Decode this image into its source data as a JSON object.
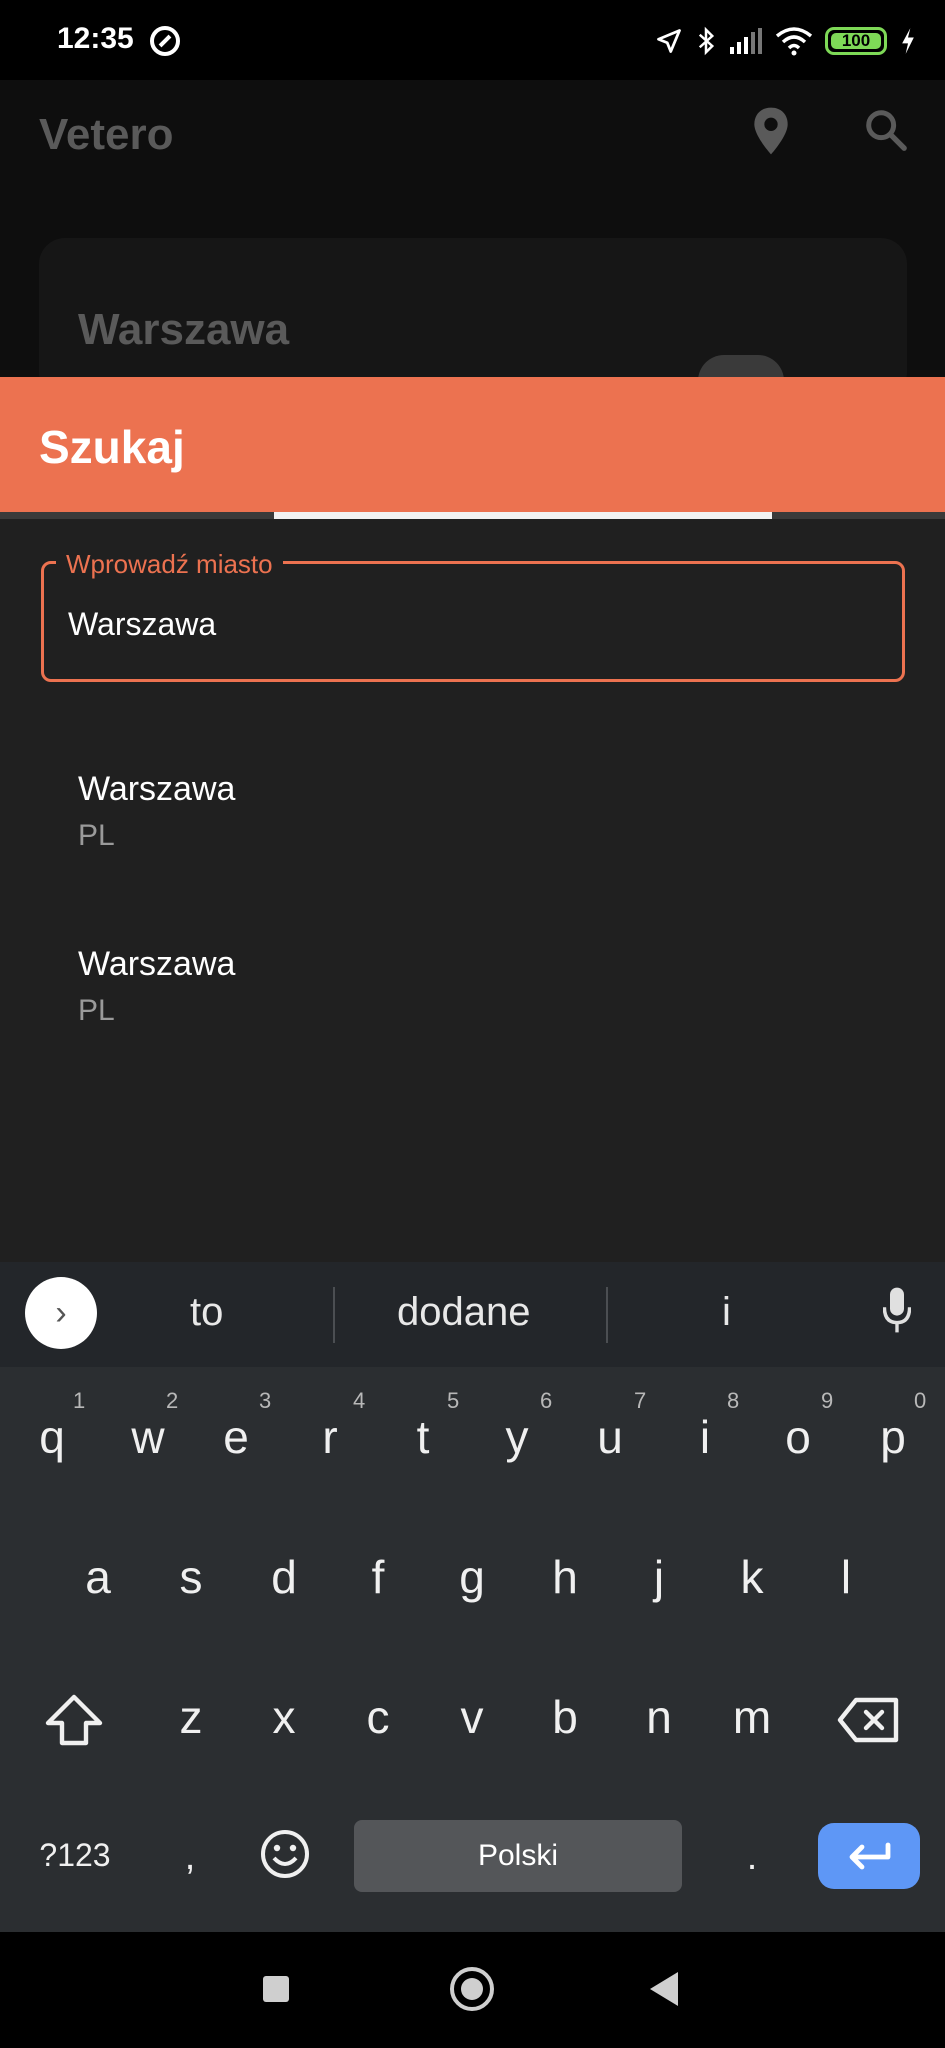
{
  "status": {
    "time": "12:35",
    "battery": "100",
    "icons": [
      "location-arrow-icon",
      "bluetooth-icon",
      "signal-icon",
      "wifi-icon",
      "battery-icon",
      "charging-icon"
    ]
  },
  "app": {
    "title": "Vetero",
    "icons": [
      "location-pin-icon",
      "search-icon"
    ],
    "card_city": "Warszawa"
  },
  "sheet": {
    "title": "Szukaj",
    "accent_color": "#ec7250",
    "field_label": "Wprowadź miasto",
    "field_value": "Warszawa",
    "results": [
      {
        "name": "Warszawa",
        "country": "PL"
      },
      {
        "name": "Warszawa",
        "country": "PL"
      }
    ]
  },
  "keyboard": {
    "suggestions": [
      "to",
      "dodane",
      "i"
    ],
    "row1": [
      "q",
      "w",
      "e",
      "r",
      "t",
      "y",
      "u",
      "i",
      "o",
      "p"
    ],
    "row1_nums": [
      "1",
      "2",
      "3",
      "4",
      "5",
      "6",
      "7",
      "8",
      "9",
      "0"
    ],
    "row2": [
      "a",
      "s",
      "d",
      "f",
      "g",
      "h",
      "j",
      "k",
      "l"
    ],
    "row3": [
      "z",
      "x",
      "c",
      "v",
      "b",
      "n",
      "m"
    ],
    "symbols_label": "?123",
    "comma": ",",
    "period": ".",
    "space_label": "Polski",
    "enter_color": "#5e97f6"
  }
}
